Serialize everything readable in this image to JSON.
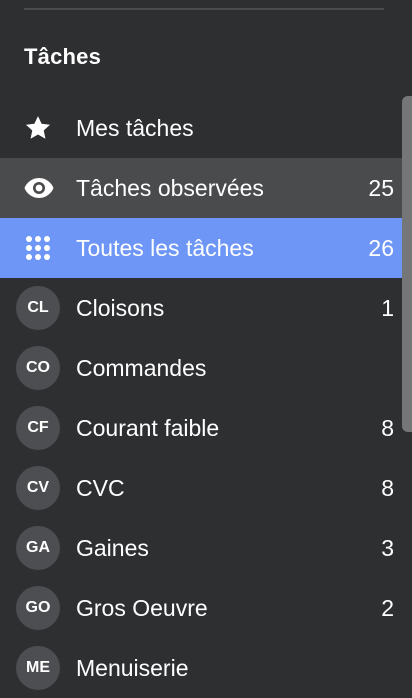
{
  "section": {
    "title": "Tâches"
  },
  "items": [
    {
      "label": "Mes tâches",
      "icon": "star-icon",
      "count": ""
    },
    {
      "label": "Tâches observées",
      "icon": "eye-icon",
      "count": "25"
    },
    {
      "label": "Toutes les tâches",
      "icon": "grid-dots-icon",
      "count": "26"
    },
    {
      "label": "Cloisons",
      "initials": "CL",
      "count": "1"
    },
    {
      "label": "Commandes",
      "initials": "CO",
      "count": ""
    },
    {
      "label": "Courant faible",
      "initials": "CF",
      "count": "8"
    },
    {
      "label": "CVC",
      "initials": "CV",
      "count": "8"
    },
    {
      "label": "Gaines",
      "initials": "GA",
      "count": "3"
    },
    {
      "label": "Gros Oeuvre",
      "initials": "GO",
      "count": "2"
    },
    {
      "label": "Menuiserie",
      "initials": "ME",
      "count": ""
    }
  ],
  "colors": {
    "background": "#2e2f31",
    "observed_row": "#4a4b4d",
    "active_row": "#6d96f6",
    "avatar": "#4d4e51"
  }
}
